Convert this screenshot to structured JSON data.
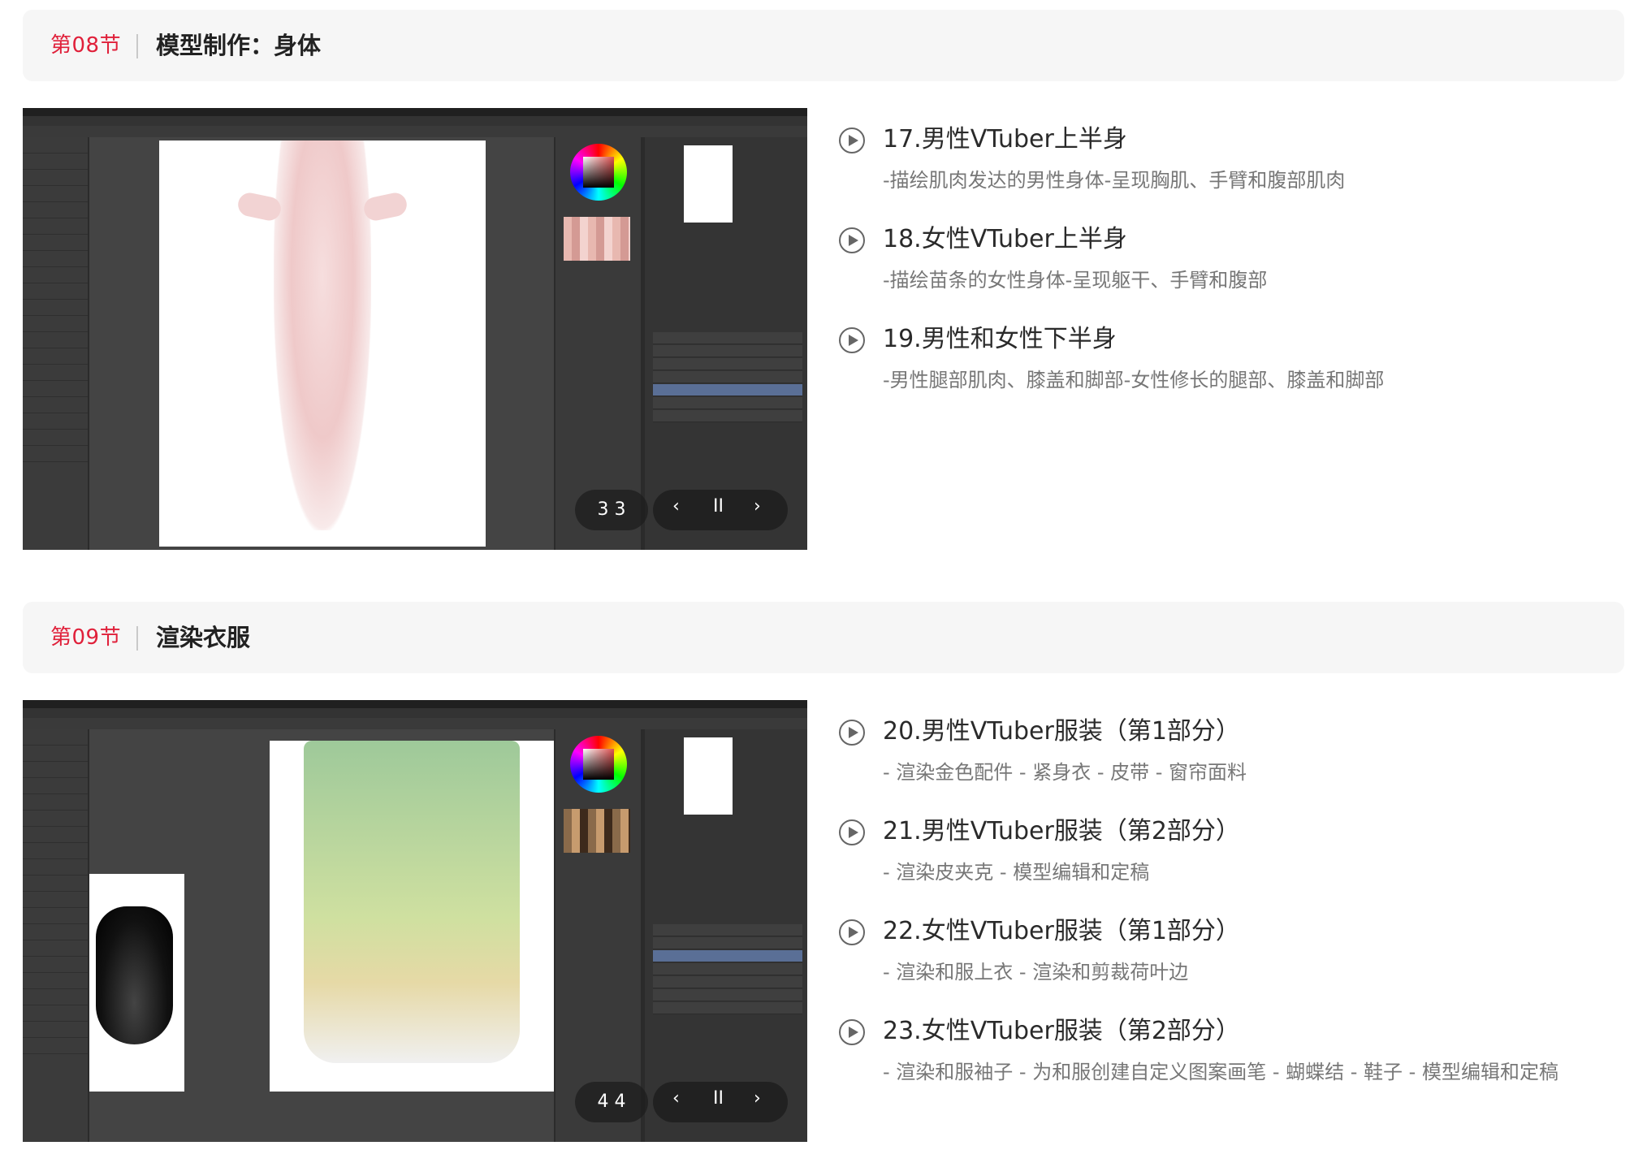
{
  "sections": [
    {
      "number": "第08节",
      "title": "模型制作：身体",
      "thumbnail": {
        "counter": "3 3",
        "prev_icon": "chevron-left-icon",
        "pause_icon": "pause-icon",
        "next_icon": "chevron-right-icon"
      },
      "lessons": [
        {
          "title": "17.男性VTuber上半身",
          "desc": "-描绘肌肉发达的男性身体-呈现胸肌、手臂和腹部肌肉"
        },
        {
          "title": "18.女性VTuber上半身",
          "desc": "-描绘苗条的女性身体-呈现躯干、手臂和腹部"
        },
        {
          "title": "19.男性和女性下半身",
          "desc": "-男性腿部肌肉、膝盖和脚部-女性修长的腿部、膝盖和脚部"
        }
      ]
    },
    {
      "number": "第09节",
      "title": "渲染衣服",
      "thumbnail": {
        "counter": "4 4",
        "prev_icon": "chevron-left-icon",
        "pause_icon": "pause-icon",
        "next_icon": "chevron-right-icon"
      },
      "lessons": [
        {
          "title": "20.男性VTuber服装（第1部分）",
          "desc": "- 渲染金色配件 - 紧身衣 - 皮带 - 窗帘面料"
        },
        {
          "title": "21.男性VTuber服装（第2部分）",
          "desc": "- 渲染皮夹克 - 模型编辑和定稿"
        },
        {
          "title": "22.女性VTuber服装（第1部分）",
          "desc": "- 渲染和服上衣 - 渲染和剪裁荷叶边"
        },
        {
          "title": "23.女性VTuber服装（第2部分）",
          "desc": "- 渲染和服袖子 - 为和服创建自定义图案画笔 - 蝴蝶结 - 鞋子 - 模型编辑和定稿"
        }
      ]
    }
  ],
  "colors": {
    "accent": "#e0203a",
    "header_bg": "#f6f6f6",
    "title": "#222222",
    "desc": "#777777"
  },
  "controls": {
    "prev": "‹",
    "pause": "II",
    "next": "›"
  }
}
